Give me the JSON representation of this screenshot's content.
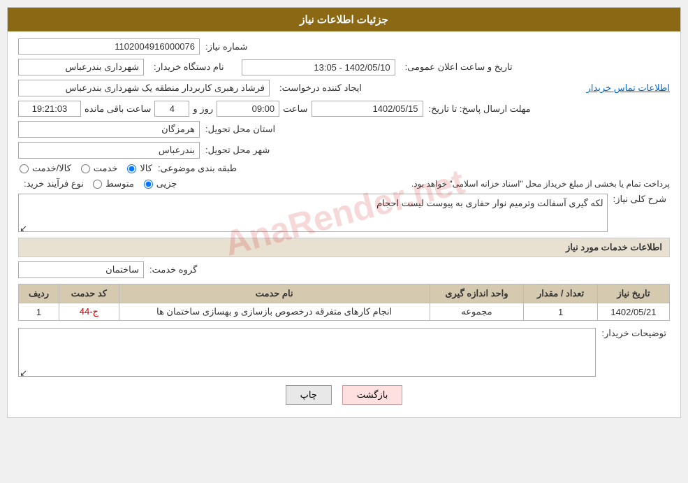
{
  "header": {
    "title": "جزئیات اطلاعات نیاز"
  },
  "fields": {
    "need_number_label": "شماره نیاز:",
    "need_number_value": "1102004916000076",
    "buyer_name_label": "نام دستگاه خریدار:",
    "buyer_name_value": "شهرداری بندرعباس",
    "public_announce_label": "تاریخ و ساعت اعلان عمومی:",
    "public_announce_value": "1402/05/10 - 13:05",
    "creator_label": "ایجاد کننده درخواست:",
    "creator_value": "فرشاد رهبری کاربردار منطقه یک شهرداری بندرعباس",
    "contact_link": "اطلاعات تماس خریدار",
    "deadline_label": "مهلت ارسال پاسخ: تا تاریخ:",
    "deadline_date": "1402/05/15",
    "deadline_time_label": "ساعت",
    "deadline_time": "09:00",
    "deadline_days_label": "روز و",
    "deadline_days": "4",
    "deadline_remaining_label": "ساعت باقی مانده",
    "deadline_remaining": "19:21:03",
    "province_label": "استان محل تحویل:",
    "province_value": "هرمزگان",
    "city_label": "شهر محل تحویل:",
    "city_value": "بندرعباس",
    "category_label": "طبقه بندی موضوعی:",
    "radio_goods": "کالا",
    "radio_service": "خدمت",
    "radio_goods_service": "کالا/خدمت",
    "purchase_type_label": "نوع فرآیند خرید:",
    "radio_partial": "جزیی",
    "radio_medium": "متوسط",
    "purchase_note": "پرداخت تمام یا بخشی از مبلغ خریداز محل \"اسناد خزانه اسلامی\" خواهد بود.",
    "description_label": "شرح کلی نیاز:",
    "description_value": "لکه گیری آسفالت وترمیم  نوار حفاری به پیوست لیست احجام",
    "services_section_label": "اطلاعات خدمات مورد نیاز",
    "service_group_label": "گروه خدمت:",
    "service_group_value": "ساختمان",
    "table": {
      "col_row": "ردیف",
      "col_code": "کد حدمت",
      "col_name": "نام حدمت",
      "col_unit": "واحد اندازه گیری",
      "col_qty": "تعداد / مقدار",
      "col_date": "تاریخ نیاز",
      "rows": [
        {
          "row": "1",
          "code": "ج-44",
          "name": "انجام کارهای متفرقه درخصوص بازسازی و بهسازی ساختمان ها",
          "unit": "مجموعه",
          "qty": "1",
          "date": "1402/05/21"
        }
      ]
    },
    "buyer_notes_label": "توضیحات خریدار:",
    "btn_back": "بازگشت",
    "btn_print": "چاپ"
  }
}
